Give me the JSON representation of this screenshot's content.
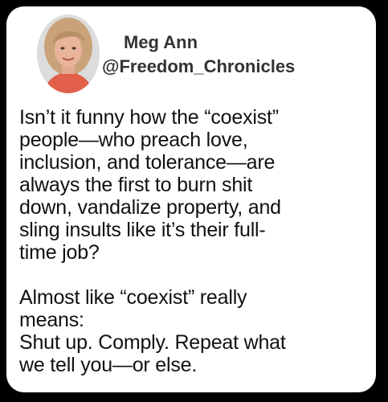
{
  "post": {
    "author_name": "Meg Ann",
    "author_handle": "@Freedom_Chronicles",
    "paragraph_1_lines": [
      "Isn’t it funny how the “coexist”",
      "people—who preach love,",
      "inclusion, and tolerance—are",
      "always the first to burn shit",
      "down, vandalize property, and",
      "sling insults like it’s their full-",
      "time job?"
    ],
    "paragraph_2_lines": [
      "Almost like “coexist” really",
      "means:",
      "Shut up. Comply. Repeat what",
      "we tell you—or else."
    ]
  },
  "colors": {
    "background": "#000000",
    "card": "#ffffff",
    "author_text": "#333333",
    "body_text": "#111111",
    "avatar_backdrop": "#dcdcdc",
    "avatar_hair": "#c9a27a",
    "avatar_skin": "#e8b49a",
    "avatar_shirt": "#e2604a"
  },
  "icons": {
    "avatar": "profile-photo-icon"
  }
}
